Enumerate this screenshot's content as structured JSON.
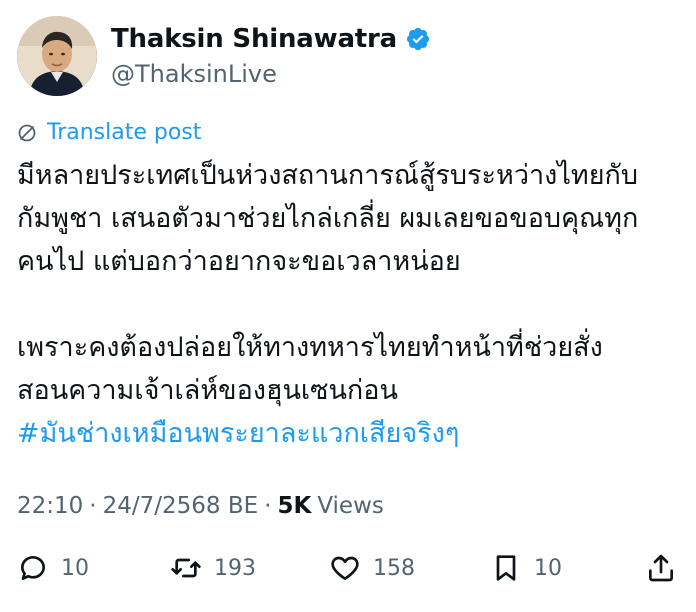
{
  "author": {
    "display_name": "Thaksin Shinawatra",
    "handle": "@ThaksinLive",
    "verified": true,
    "verified_color": "#1d9bf0"
  },
  "translate_label": "Translate post",
  "post": {
    "line1": "มีหลายประเทศเป็นห่วงสถานการณ์สู้รบระหว่างไทยกับ",
    "line2": "กัมพูชา เสนอตัวมาช่วยไกล่เกลี่ย ผมเลยขอขอบคุณทุก",
    "line3": "คนไป แต่บอกว่าอยากจะขอเวลาหน่อย",
    "line4": "เพราะคงต้องปล่อยให้ทางทหารไทยทำหน้าที่ช่วยสั่ง",
    "line5": "สอนความเจ้าเล่ห์ของฮุนเซนก่อน",
    "hashtag": "#มันช่างเหมือนพระยาละแวกเสียจริงๆ"
  },
  "meta": {
    "time": "22:10",
    "separator": "·",
    "date": "24/7/2568 BE",
    "views_count": "5K",
    "views_label": "Views"
  },
  "actions": {
    "replies": "10",
    "reposts": "193",
    "likes": "158",
    "bookmarks": "10"
  },
  "colors": {
    "link": "#1d9bf0",
    "secondary": "#536471",
    "primary": "#0f1419"
  }
}
